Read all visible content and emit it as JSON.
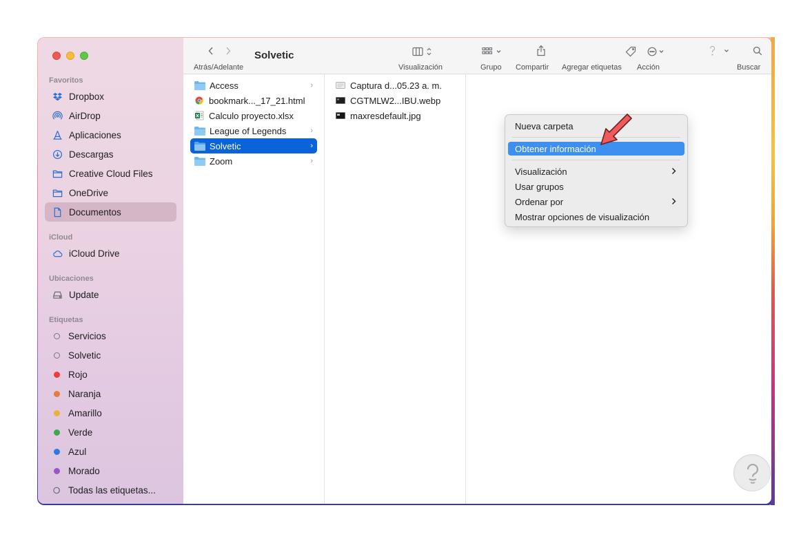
{
  "window": {
    "title": "Solvetic"
  },
  "toolbar": {
    "nav_label": "Atrás/Adelante",
    "view_label": "Visualización",
    "group_label": "Grupo",
    "share_label": "Compartir",
    "tags_label": "Agregar etiquetas",
    "action_label": "Acción",
    "search_label": "Buscar"
  },
  "sidebar": {
    "favorites_header": "Favoritos",
    "favorites": [
      {
        "label": "Dropbox",
        "icon": "dropbox-icon"
      },
      {
        "label": "AirDrop",
        "icon": "airdrop-icon"
      },
      {
        "label": "Aplicaciones",
        "icon": "applications-icon"
      },
      {
        "label": "Descargas",
        "icon": "downloads-icon"
      },
      {
        "label": "Creative Cloud Files",
        "icon": "folder-icon"
      },
      {
        "label": "OneDrive",
        "icon": "folder-icon"
      },
      {
        "label": "Documentos",
        "icon": "document-icon",
        "selected": true
      }
    ],
    "icloud_header": "iCloud",
    "icloud": [
      {
        "label": "iCloud Drive",
        "icon": "cloud-icon"
      }
    ],
    "locations_header": "Ubicaciones",
    "locations": [
      {
        "label": "Update",
        "icon": "disk-icon"
      }
    ],
    "tags_header": "Etiquetas",
    "tags": [
      {
        "label": "Servicios",
        "color": ""
      },
      {
        "label": "Solvetic",
        "color": ""
      },
      {
        "label": "Rojo",
        "color": "#ee3b3f"
      },
      {
        "label": "Naranja",
        "color": "#e87a3c"
      },
      {
        "label": "Amarillo",
        "color": "#e8b33a"
      },
      {
        "label": "Verde",
        "color": "#3fa94d"
      },
      {
        "label": "Azul",
        "color": "#2f78e8"
      },
      {
        "label": "Morado",
        "color": "#9b55c9"
      }
    ],
    "all_tags": "Todas las etiquetas..."
  },
  "column1": [
    {
      "label": "Access",
      "type": "folder",
      "has_children": true
    },
    {
      "label": "bookmark..._17_21.html",
      "type": "html"
    },
    {
      "label": "Calculo proyecto.xlsx",
      "type": "xlsx"
    },
    {
      "label": "League of Legends",
      "type": "folder",
      "has_children": true
    },
    {
      "label": "Solvetic",
      "type": "folder",
      "has_children": true,
      "selected": true
    },
    {
      "label": "Zoom",
      "type": "folder",
      "has_children": true
    }
  ],
  "column2": [
    {
      "label": "Captura d...05.23 a. m.",
      "type": "screenshot"
    },
    {
      "label": "CGTMLW2...IBU.webp",
      "type": "image-dark"
    },
    {
      "label": "maxresdefault.jpg",
      "type": "image-dark"
    }
  ],
  "context_menu": {
    "items": [
      {
        "label": "Nueva carpeta"
      },
      {
        "label": "Obtener información",
        "highlighted": true
      },
      {
        "label": "Visualización",
        "submenu": true
      },
      {
        "label": "Usar grupos"
      },
      {
        "label": "Ordenar por",
        "submenu": true
      },
      {
        "label": "Mostrar opciones de visualización"
      }
    ]
  },
  "colors": {
    "accent": "#0a63d8",
    "menu_highlight": "#3d8ff0",
    "annotation_arrow": "#ef5a5a"
  }
}
